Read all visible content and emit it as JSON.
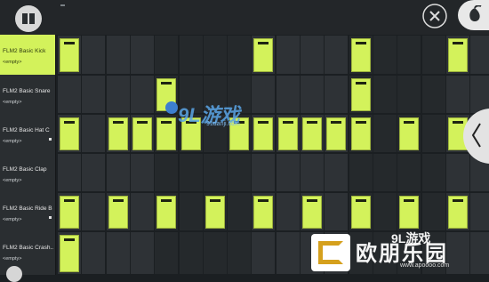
{
  "app": {
    "accent": "#d3f25b"
  },
  "toolbar": {
    "menu_icon": "piano-roll-menu-icon",
    "close_icon": "close-icon",
    "fruit_icon": "fl-fruit-icon"
  },
  "side_panel": {
    "arrow_icon": "chevron-left-icon"
  },
  "channels": [
    {
      "name": "FLM2 Basic Kick",
      "sub": "<empty>",
      "selected": true
    },
    {
      "name": "FLM2 Basic Snare",
      "sub": "<empty>",
      "selected": false
    },
    {
      "name": "FLM2 Basic Hat C",
      "sub": "<empty>",
      "selected": false
    },
    {
      "name": "FLM2 Basic Clap",
      "sub": "<empty>",
      "selected": false
    },
    {
      "name": "FLM2 Basic Ride B",
      "sub": "<empty>",
      "selected": false
    },
    {
      "name": "FLM2 Basic Crash..",
      "sub": "<empty>",
      "selected": false
    }
  ],
  "steps": [
    [
      0,
      8,
      12,
      16
    ],
    [
      4,
      12
    ],
    [
      0,
      2,
      3,
      4,
      5,
      7,
      8,
      9,
      10,
      11,
      12,
      14,
      16
    ],
    [],
    [
      0,
      2,
      4,
      6,
      8,
      10,
      12,
      14,
      16
    ],
    [
      0
    ]
  ],
  "watermarks": {
    "logo1": "9L游戏",
    "logo1_url": "91danji.com",
    "logo2": "欧朋乐园",
    "logo2_url": "www.apoooo.com",
    "corner": "9L游戏"
  }
}
